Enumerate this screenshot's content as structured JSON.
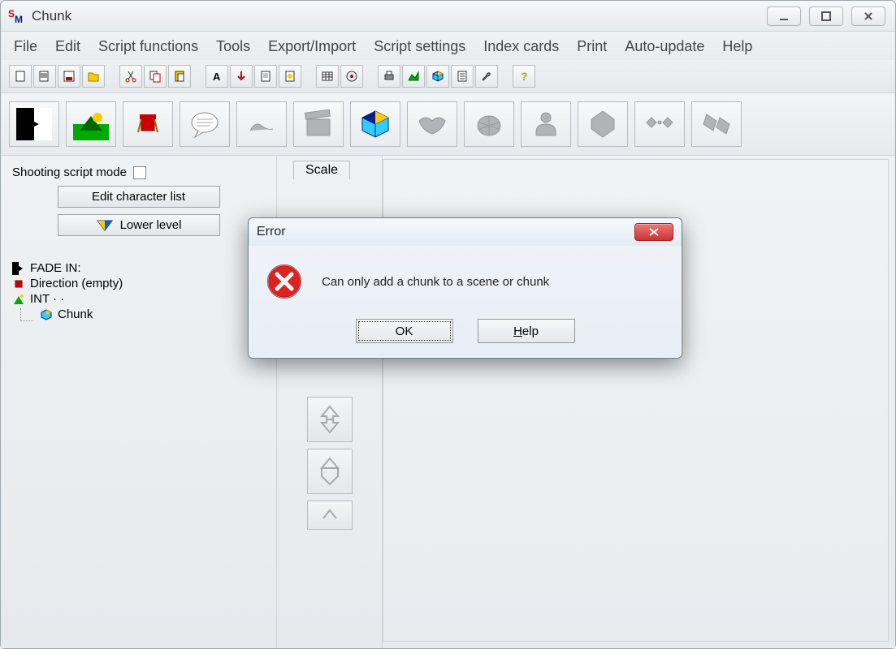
{
  "window": {
    "title": "Chunk"
  },
  "menus": [
    "File",
    "Edit",
    "Script functions",
    "Tools",
    "Export/Import",
    "Script settings",
    "Index cards",
    "Print",
    "Auto-update",
    "Help"
  ],
  "toolbar_groups": [
    [
      "new",
      "open",
      "save",
      "folder"
    ],
    [
      "cut",
      "copy",
      "paste"
    ],
    [
      "font",
      "down",
      "page",
      "script-page"
    ],
    [
      "grid",
      "disc"
    ],
    [
      "print",
      "chart",
      "cube",
      "props",
      "wrench"
    ],
    [
      "help"
    ]
  ],
  "big_toolbar": [
    {
      "name": "transition",
      "enabled": true
    },
    {
      "name": "scene",
      "enabled": true
    },
    {
      "name": "director",
      "enabled": true
    },
    {
      "name": "dialogue",
      "enabled": true
    },
    {
      "name": "slug",
      "enabled": false
    },
    {
      "name": "clapper",
      "enabled": false
    },
    {
      "name": "chunk",
      "enabled": true
    },
    {
      "name": "bat",
      "enabled": false
    },
    {
      "name": "turtle",
      "enabled": false
    },
    {
      "name": "char",
      "enabled": false
    },
    {
      "name": "hex",
      "enabled": false
    },
    {
      "name": "link",
      "enabled": false
    },
    {
      "name": "split",
      "enabled": false
    }
  ],
  "sidebar": {
    "shooting_label": "Shooting script mode",
    "edit_characters": "Edit character list",
    "lower_level": "Lower level",
    "tree": [
      {
        "icon": "transition",
        "label": "FADE IN:",
        "indent": 0
      },
      {
        "icon": "direction",
        "label": "Direction (empty)",
        "indent": 0
      },
      {
        "icon": "scene",
        "label": "INT ·  ·",
        "indent": 0
      },
      {
        "icon": "chunk",
        "label": "Chunk",
        "indent": 1
      }
    ]
  },
  "scale_tab": "Scale",
  "dialog": {
    "title": "Error",
    "message": "Can only add a chunk to a scene or chunk",
    "ok": "OK",
    "help": "Help"
  }
}
